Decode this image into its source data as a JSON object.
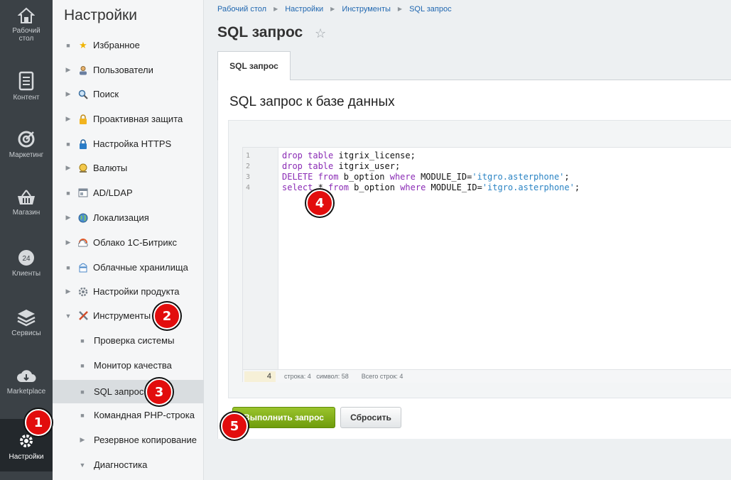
{
  "leftbar": {
    "items": [
      {
        "label": "Рабочий стол",
        "icon": "home-icon"
      },
      {
        "label": "Контент",
        "icon": "document-icon"
      },
      {
        "label": "Маркетинг",
        "icon": "target-icon"
      },
      {
        "label": "Магазин",
        "icon": "basket-icon"
      },
      {
        "label": "Клиенты",
        "icon": "clock-24-icon"
      },
      {
        "label": "Сервисы",
        "icon": "layers-icon"
      },
      {
        "label": "Marketplace",
        "icon": "cloud-icon"
      },
      {
        "label": "Настройки",
        "icon": "gear-icon"
      }
    ]
  },
  "menu": {
    "title": "Настройки",
    "items": [
      {
        "label": "Избранное",
        "icon": "star-icon"
      },
      {
        "label": "Пользователи",
        "icon": "user-icon"
      },
      {
        "label": "Поиск",
        "icon": "magnifier-icon"
      },
      {
        "label": "Проактивная защита",
        "icon": "lock-icon"
      },
      {
        "label": "Настройка HTTPS",
        "icon": "https-lock-icon"
      },
      {
        "label": "Валюты",
        "icon": "currency-icon"
      },
      {
        "label": "AD/LDAP",
        "icon": "ldap-icon"
      },
      {
        "label": "Локализация",
        "icon": "globe-icon"
      },
      {
        "label": "Облако 1С-Битрикс",
        "icon": "cloud-bitrix-icon"
      },
      {
        "label": "Облачные хранилища",
        "icon": "cloud-storage-icon"
      },
      {
        "label": "Настройки продукта",
        "icon": "settings-icon"
      },
      {
        "label": "Инструменты",
        "icon": "tools-icon"
      },
      {
        "label": "Проверка системы"
      },
      {
        "label": "Монитор качества"
      },
      {
        "label": "SQL запрос"
      },
      {
        "label": "Командная PHP-строка"
      },
      {
        "label": "Резервное копирование"
      },
      {
        "label": "Диагностика"
      }
    ]
  },
  "breadcrumbs": [
    "Рабочий стол",
    "Настройки",
    "Инструменты",
    "SQL запрос"
  ],
  "page": {
    "title": "SQL запрос",
    "tab": "SQL запрос",
    "panel_heading": "SQL запрос к базе данных"
  },
  "editor": {
    "line_numbers": [
      "1",
      "2",
      "3",
      "4"
    ],
    "status_line": "4",
    "status_text": "строка: 4   символ: 58",
    "status_total": "Всего строк: 4"
  },
  "buttons": {
    "run": "Выполнить запрос",
    "reset": "Сбросить"
  },
  "markers": [
    "1",
    "2",
    "3",
    "4",
    "5"
  ],
  "colors": {
    "leftbar": "#3b4146",
    "accent_link": "#2067b0",
    "run_button": "#7aa614",
    "marker": "#e20d0d"
  }
}
